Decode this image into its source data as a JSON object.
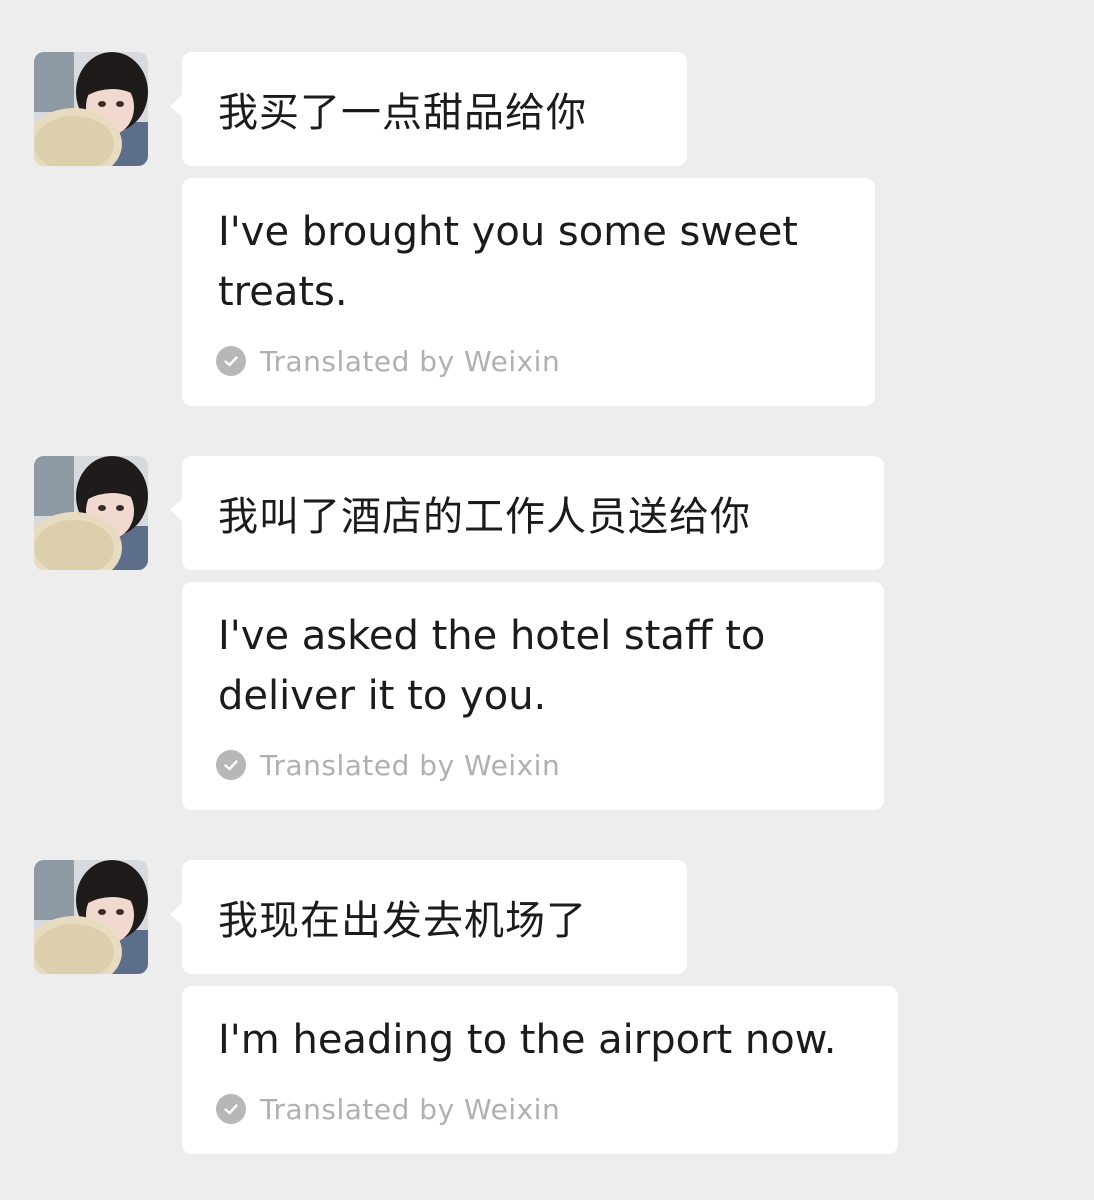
{
  "messages": [
    {
      "original": "我买了一点甜品给你",
      "translation": "I've brought you some sweet treats.",
      "translated_by": "Translated by Weixin"
    },
    {
      "original": "我叫了酒店的工作人员送给你",
      "translation": "I've asked the hotel staff to deliver it to you.",
      "translated_by": "Translated by Weixin"
    },
    {
      "original": "我现在出发去机场了",
      "translation": "I'm heading to the airport now.",
      "translated_by": "Translated by Weixin"
    }
  ],
  "colors": {
    "background": "#ededed",
    "bubble": "#ffffff",
    "text": "#1b1b1b",
    "muted": "#b0b0b0"
  },
  "icons": {
    "avatar": "avatar",
    "translated": "check-circle-icon"
  }
}
